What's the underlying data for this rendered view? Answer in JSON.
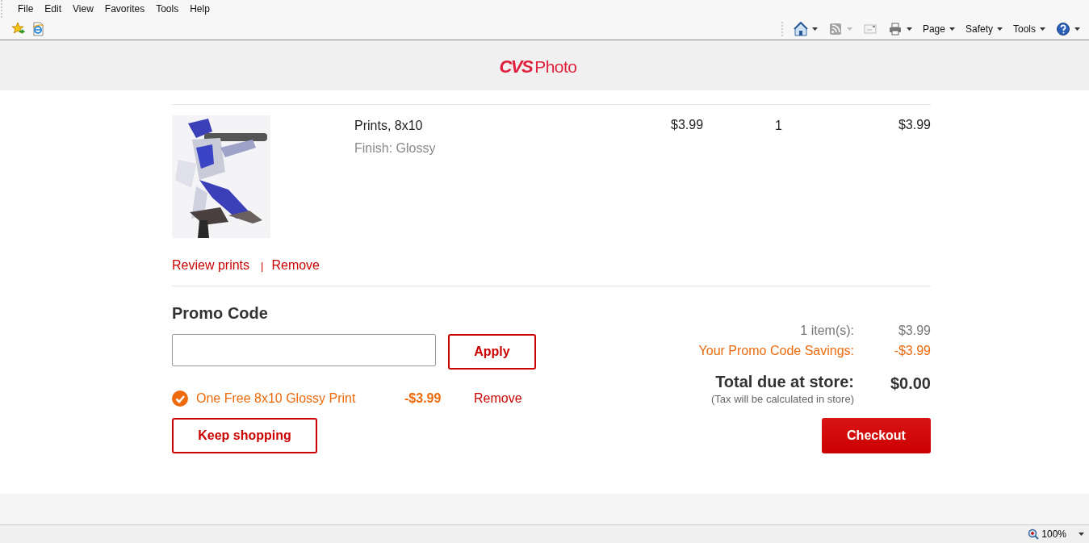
{
  "menu": [
    {
      "label": "File"
    },
    {
      "label": "Edit"
    },
    {
      "label": "View"
    },
    {
      "label": "Favorites"
    },
    {
      "label": "Tools"
    },
    {
      "label": "Help"
    }
  ],
  "favorites_bar": [
    {
      "kind": "favorites"
    },
    {
      "kind": "suggested"
    }
  ],
  "command_bar": [
    {
      "kind": "home",
      "dropdown": true,
      "disabled": false
    },
    {
      "kind": "feeds",
      "dropdown": true,
      "disabled": true
    },
    {
      "kind": "mail",
      "dropdown": false,
      "disabled": true
    },
    {
      "kind": "print",
      "dropdown": true,
      "disabled": false
    },
    {
      "kind": "menu",
      "label": "Page",
      "dropdown": true,
      "disabled": false
    },
    {
      "kind": "menu",
      "label": "Safety",
      "dropdown": true,
      "disabled": false
    },
    {
      "kind": "menu",
      "label": "Tools",
      "dropdown": true,
      "disabled": false
    },
    {
      "kind": "help",
      "dropdown": true,
      "disabled": false
    }
  ],
  "header": {
    "brand": "CVS",
    "product": "Photo"
  },
  "cart_item": {
    "name": "Prints, 8x10",
    "finish": "Finish: Glossy",
    "price": "$3.99",
    "quantity": "1",
    "total": "$3.99",
    "links": [
      "Review prints",
      "Remove"
    ],
    "separator": "|"
  },
  "promo": {
    "heading": "Promo Code",
    "apply_button": "Apply",
    "applied": [
      {
        "label": "One Free 8x10 Glossy Print",
        "amount": "-$3.99",
        "remove": "Remove"
      }
    ]
  },
  "summary": {
    "rows": [
      {
        "kind": "subtotal",
        "label": "1 item(s):",
        "value": "$3.99"
      },
      {
        "kind": "savings",
        "label": "Your Promo Code Savings:",
        "value": "-$3.99"
      }
    ],
    "total": {
      "label": "Total due at store:",
      "value": "$0.00",
      "note": "(Tax will be calculated in store)"
    }
  },
  "buttons": {
    "keep_shopping": "Keep shopping",
    "checkout": "Checkout"
  },
  "status_bar": {
    "zoom": "100%"
  }
}
